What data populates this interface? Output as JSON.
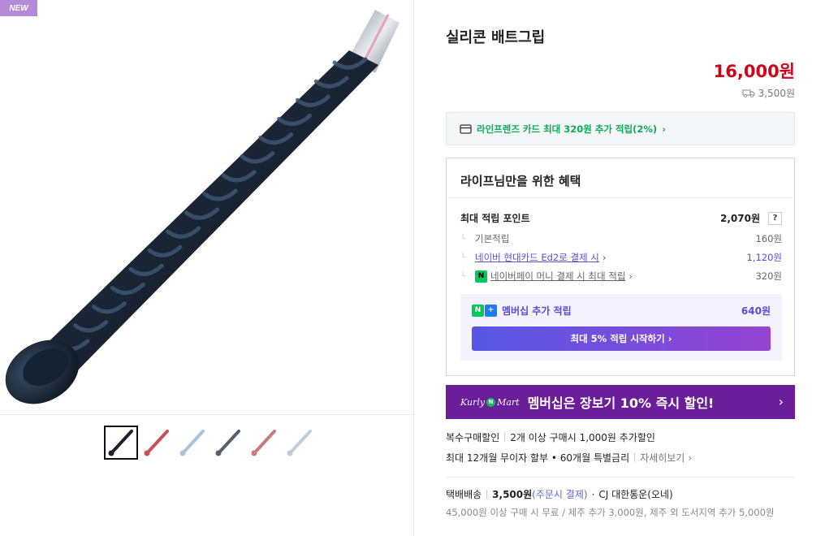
{
  "badge": "NEW",
  "product": {
    "title": "실리콘 배트그립",
    "price": "16,000원",
    "shipping_fee": "3,500원"
  },
  "card_benefit": "라인프렌즈 카드 최대 320원 추가 적립(2%)",
  "benefit": {
    "title": "라이프님만을 위한 혜택",
    "max_point_label": "최대 적립 포인트",
    "max_point_value": "2,070원",
    "help": "?",
    "items": [
      {
        "label": "기본적립",
        "value": "160원"
      },
      {
        "label": "네이버 현대카드 Ed2로 결제 시",
        "value": "1,120원"
      },
      {
        "label": "네이버페이 머니 결제 시 최대 적립",
        "value": "320원"
      }
    ],
    "membership_label": "멤버십 추가 적립",
    "membership_value": "640원",
    "membership_button": "최대 5% 적립 시작하기"
  },
  "banner": {
    "logo_left": "Kurly",
    "logo_mid": "N",
    "logo_right": "Mart",
    "text": "멤버십은 장보기 10% 즉시 할인!"
  },
  "discount": {
    "label": "복수구매할인",
    "value": "2개 이상 구매시 1,000원 추가할인"
  },
  "installment": {
    "text": "최대 12개월 무이자 할부 • 60개월 특별금리",
    "link": "자세히보기"
  },
  "delivery": {
    "type": "택배배송",
    "fee": "3,500원",
    "payment": "(주문시 결제)",
    "courier": "CJ 대한통운(오네)",
    "note": "45,000원 이상 구매 시 무료 / 제주 추가 3,000원, 제주 외 도서지역 추가 5,000원"
  },
  "thumbnails": [
    {
      "name": "black",
      "color": "#1a2230",
      "active": true
    },
    {
      "name": "red",
      "color": "#c8505a",
      "active": false
    },
    {
      "name": "light-blue",
      "color": "#a9c4da",
      "active": false
    },
    {
      "name": "gray",
      "color": "#56606c",
      "active": false
    },
    {
      "name": "pink",
      "color": "#c97a80",
      "active": false
    },
    {
      "name": "sky",
      "color": "#b9cfe0",
      "active": false
    }
  ]
}
